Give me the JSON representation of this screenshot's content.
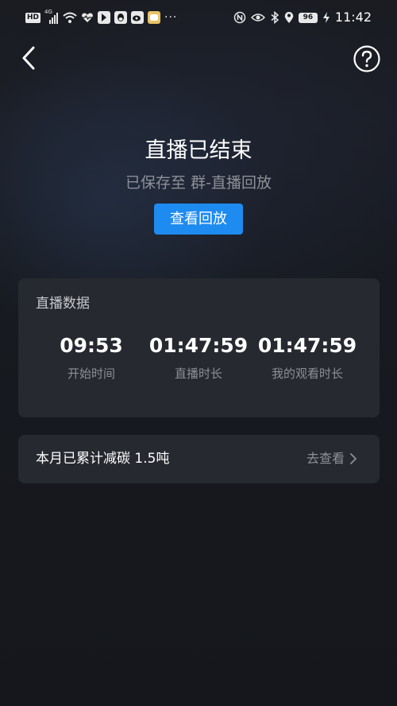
{
  "status_bar": {
    "hd_badge": "HD",
    "network": "4G",
    "battery": "96",
    "time": "11:42",
    "more": "···"
  },
  "header": {
    "back_icon": "chevron-left-icon",
    "help_icon": "question-circle-icon"
  },
  "hero": {
    "title": "直播已结束",
    "subtitle": "已保存至 群-直播回放",
    "replay_button": "查看回放"
  },
  "stats": {
    "title": "直播数据",
    "items": [
      {
        "value": "09:53",
        "label": "开始时间"
      },
      {
        "value": "01:47:59",
        "label": "直播时长"
      },
      {
        "value": "01:47:59",
        "label": "我的观看时长"
      }
    ]
  },
  "carbon": {
    "text": "本月已累计减碳 1.5吨",
    "link": "去查看"
  },
  "colors": {
    "accent": "#1e8bf0",
    "card": "#262930",
    "background": "#15171c",
    "muted_text": "#8d9097"
  }
}
